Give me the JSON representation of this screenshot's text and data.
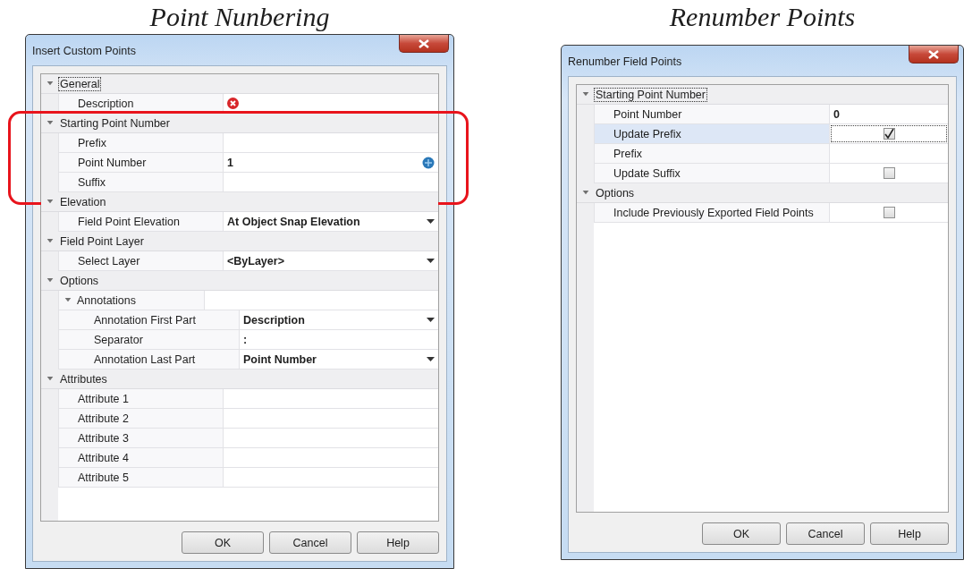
{
  "dialogs": [
    {
      "caption": "Point Nunbering",
      "title": "Insert Custom Points",
      "grid": [
        {
          "kind": "category",
          "label": "General",
          "expanded": true,
          "children": [
            {
              "kind": "error",
              "label": "Description"
            }
          ]
        },
        {
          "kind": "category",
          "label": "Starting Point Number",
          "expanded": true,
          "highlighted": true,
          "children": [
            {
              "kind": "text",
              "label": "Prefix"
            },
            {
              "kind": "spin",
              "label": "Point Number",
              "value": "1"
            },
            {
              "kind": "text",
              "label": "Suffix"
            }
          ]
        },
        {
          "kind": "category",
          "label": "Elevation",
          "expanded": true,
          "children": [
            {
              "kind": "dropdown",
              "label": "Field Point Elevation",
              "value": "At Object Snap Elevation"
            }
          ]
        },
        {
          "kind": "category",
          "label": "Field Point Layer",
          "expanded": true,
          "children": [
            {
              "kind": "dropdown",
              "label": "Select Layer",
              "value": "<ByLayer>"
            }
          ]
        },
        {
          "kind": "category",
          "label": "Options",
          "expanded": true,
          "children": [
            {
              "kind": "category",
              "label": "Annotations",
              "expanded": true,
              "children": [
                {
                  "kind": "dropdown",
                  "label": "Annotation First Part",
                  "value": "Description"
                },
                {
                  "kind": "text",
                  "label": "Separator",
                  "value": ":"
                },
                {
                  "kind": "dropdown",
                  "label": "Annotation Last Part",
                  "value": "Point Number"
                }
              ]
            }
          ]
        },
        {
          "kind": "category",
          "label": "Attributes",
          "expanded": true,
          "children": [
            {
              "kind": "text",
              "label": "Attribute 1"
            },
            {
              "kind": "text",
              "label": "Attribute 2"
            },
            {
              "kind": "text",
              "label": "Attribute 3"
            },
            {
              "kind": "text",
              "label": "Attribute 4"
            },
            {
              "kind": "text",
              "label": "Attribute 5"
            }
          ]
        }
      ],
      "buttons": [
        "OK",
        "Cancel",
        "Help"
      ]
    },
    {
      "caption": "Renumber Points",
      "title": "Renumber Field Points",
      "grid": [
        {
          "kind": "category",
          "label": "Starting Point Number",
          "expanded": true,
          "children": [
            {
              "kind": "text",
              "label": "Point Number",
              "value": "0",
              "selected": false
            },
            {
              "kind": "checkbox",
              "label": "Update Prefix",
              "checked": true,
              "selected": true
            },
            {
              "kind": "text",
              "label": "Prefix",
              "selected": false
            },
            {
              "kind": "checkbox",
              "label": "Update Suffix",
              "checked": false,
              "selected": false
            }
          ]
        },
        {
          "kind": "category",
          "label": "Options",
          "expanded": true,
          "children": [
            {
              "kind": "checkbox",
              "label": "Include Previously Exported Field Points",
              "checked": false,
              "selected": false
            }
          ]
        }
      ],
      "buttons": [
        "OK",
        "Cancel",
        "Help"
      ]
    }
  ]
}
